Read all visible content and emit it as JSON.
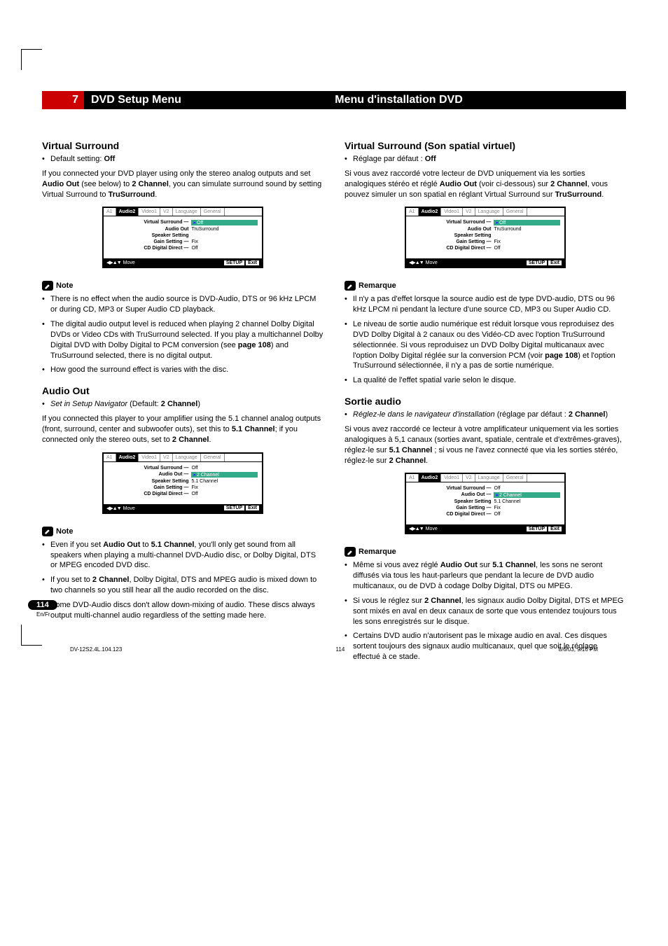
{
  "header": {
    "chapter": "7",
    "title_en": "DVD Setup Menu",
    "title_fr": "Menu d'installation DVD"
  },
  "en": {
    "vs_title": "Virtual Surround",
    "vs_default": "Default setting: ",
    "vs_default_val": "Off",
    "vs_body": "If you connected your DVD player using only the stereo analog outputs and set ",
    "vs_body_b1": "Audio Out",
    "vs_body_mid": " (see below) to ",
    "vs_body_b2": "2 Channel",
    "vs_body_end": ", you can simulate surround sound by setting Virtual Surround to ",
    "vs_body_b3": "TruSurround",
    "vs_body_period": ".",
    "note_label": "Note",
    "vs_n1": "There is no effect when the audio source is DVD-Audio, DTS or 96 kHz LPCM or during CD, MP3 or Super Audio CD playback.",
    "vs_n2_a": "The digital audio output level is reduced when playing 2 channel Dolby Digital DVDs or Video CDs with TruSurround selected. If you play a multichannel Dolby Digital DVD with Dolby Digital to PCM conversion (see ",
    "vs_n2_b": "page 108",
    "vs_n2_c": ") and TruSurround selected, there is no digital output.",
    "vs_n3": "How good the surround effect is varies with the disc.",
    "ao_title": "Audio Out",
    "ao_set_i": "Set in Setup Navigator",
    "ao_set_rest": " (Default: ",
    "ao_set_val": "2 Channel",
    "ao_set_close": ")",
    "ao_body_a": "If you connected this player to your amplifier using the 5.1 channel analog outputs (front, surround, center and subwoofer outs), set this to ",
    "ao_body_b1": "5.1 Channel",
    "ao_body_mid": "; if you connected only the stereo outs, set to ",
    "ao_body_b2": "2 Channel",
    "ao_body_end": ".",
    "ao_n1_a": "Even if you set ",
    "ao_n1_b": "Audio Out",
    "ao_n1_c": " to ",
    "ao_n1_d": "5.1 Channel",
    "ao_n1_e": ", you'll only get sound from all speakers when playing a multi-channel DVD-Audio disc, or Dolby Digital, DTS or MPEG encoded DVD disc.",
    "ao_n2_a": "If you set to ",
    "ao_n2_b": "2 Channel",
    "ao_n2_c": ", Dolby Digital, DTS and MPEG audio is mixed down to two channels so you still hear all the audio recorded on the disc.",
    "ao_n3": "Some DVD-Audio discs don't allow down-mixing of audio. These discs always output multi-channel audio regardless of the setting made here."
  },
  "fr": {
    "vs_title": "Virtual Surround (Son spatial virtuel)",
    "vs_default": "Réglage par défaut : ",
    "vs_default_val": "Off",
    "vs_body_a": "Si vous avez raccordé votre lecteur de DVD uniquement via les sorties analogiques stéréo et réglé ",
    "vs_body_b1": "Audio Out",
    "vs_body_mid": " (voir ci-dessous) sur ",
    "vs_body_b2": "2 Channel",
    "vs_body_end": ", vous pouvez simuler un son spatial en réglant Virtual Surround sur ",
    "vs_body_b3": "TruSurround",
    "vs_body_period": ".",
    "note_label": "Remarque",
    "vs_n1": "Il n'y a pas d'effet lorsque la source audio est de type DVD-audio, DTS ou 96 kHz LPCM ni pendant la lecture d'une source CD, MP3 ou Super Audio CD.",
    "vs_n2_a": "Le niveau de sortie audio numérique est réduit lorsque vous reproduisez des DVD Dolby Digital à 2 canaux ou des Vidéo-CD avec l'option TruSurround sélectionnée. Si vous reproduisez un DVD Dolby Digital multicanaux avec l'option Dolby Digital réglée sur la conversion PCM (voir ",
    "vs_n2_b": "page 108",
    "vs_n2_c": ") et l'option TruSurround sélectionnée, il n'y a pas de sortie numérique.",
    "vs_n3": "La qualité de l'effet spatial varie selon le disque.",
    "ao_title": "Sortie audio",
    "ao_set_i": "Réglez-le dans le navigateur d'installation",
    "ao_set_rest": " (réglage par défaut : ",
    "ao_set_val": "2 Channel",
    "ao_set_close": ")",
    "ao_body_a": "Si vous avez raccordé ce lecteur à votre amplificateur uniquement via les sorties analogiques à 5,1 canaux (sorties avant, spatiale, centrale et d'extrêmes-graves), réglez-le sur ",
    "ao_body_b1": "5.1 Channel",
    "ao_body_mid": " ; si vous ne l'avez connecté que via les sorties stéréo, réglez-le sur ",
    "ao_body_b2": "2 Channel",
    "ao_body_end": ".",
    "ao_n1_a": "Même si vous avez réglé ",
    "ao_n1_b": "Audio Out",
    "ao_n1_c": " sur ",
    "ao_n1_d": "5.1 Channel",
    "ao_n1_e": ", les sons ne seront diffusés via tous les haut-parleurs que pendant la lecure de DVD audio multicanaux, ou de DVD à codage Dolby Digital, DTS ou MPEG.",
    "ao_n2_a": "Si vous le réglez sur ",
    "ao_n2_b": "2 Channel",
    "ao_n2_c": ", les signaux audio Dolby Digital, DTS et MPEG sont mixés en aval en deux canaux de sorte que vous entendez toujours tous les sons enregistrés sur le disque.",
    "ao_n3": "Certains DVD audio n'autorisent pas le mixage audio en aval. Ces disques sortent toujours des signaux audio multicanaux, quel que soit le réglage effectué à ce stade."
  },
  "osd": {
    "tabs": [
      "A1",
      "Audio2",
      "Video1",
      "V2",
      "Language",
      "General"
    ],
    "rows_vs": [
      {
        "k": "Virtual Surround —",
        "v": "Off",
        "hl": true
      },
      {
        "k": "Audio Out",
        "v": "TruSurround",
        "opt": true
      },
      {
        "k": "Speaker Setting",
        "v": ""
      },
      {
        "k": "Gain Setting —",
        "v": "Fix"
      },
      {
        "k": "CD Digital Direct —",
        "v": "Off"
      }
    ],
    "rows_ao": [
      {
        "k": "Virtual Surround —",
        "v": "Off"
      },
      {
        "k": "Audio Out —",
        "v": "2 Channel",
        "hl": true
      },
      {
        "k": "Speaker Setting",
        "v": "5.1 Channel",
        "opt": true
      },
      {
        "k": "Gain Setting —",
        "v": "Fix"
      },
      {
        "k": "CD Digital Direct —",
        "v": "Off"
      }
    ],
    "move": "Move",
    "setup": "SETUP",
    "exit": "Exit"
  },
  "footer": {
    "page": "114",
    "locale": "En/Fr",
    "file": "DV-12S2.4L.104.123",
    "mid": "114",
    "time": "8/6/03, 9:16 PM"
  }
}
